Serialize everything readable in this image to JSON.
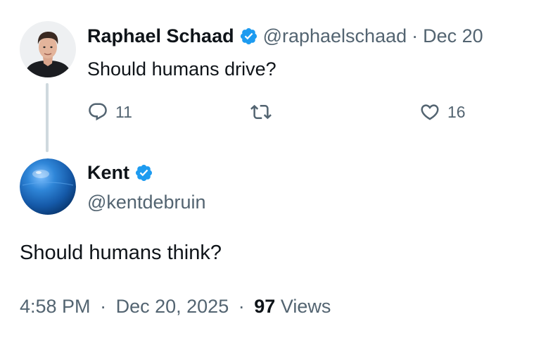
{
  "reply_tweet": {
    "author_name": "Raphael Schaad",
    "author_handle": "@raphaelschaad",
    "separator": "·",
    "date": "Dec 20",
    "text": "Should humans drive?",
    "reply_count": "11",
    "like_count": "16",
    "avatar_icon": "person-avatar",
    "verified_icon": "verified-badge-icon"
  },
  "main_tweet": {
    "author_name": "Kent",
    "author_handle": "@kentdebruin",
    "text": "Should humans think?",
    "time": "4:58 PM",
    "separator": "·",
    "date": "Dec 20, 2025",
    "views_count": "97",
    "views_label": "Views",
    "avatar_icon": "blue-exercise-ball-avatar"
  },
  "colors": {
    "text_primary": "#0f1419",
    "text_secondary": "#536471",
    "verified_blue": "#1d9bf0",
    "thread_line": "#cfd9de"
  }
}
